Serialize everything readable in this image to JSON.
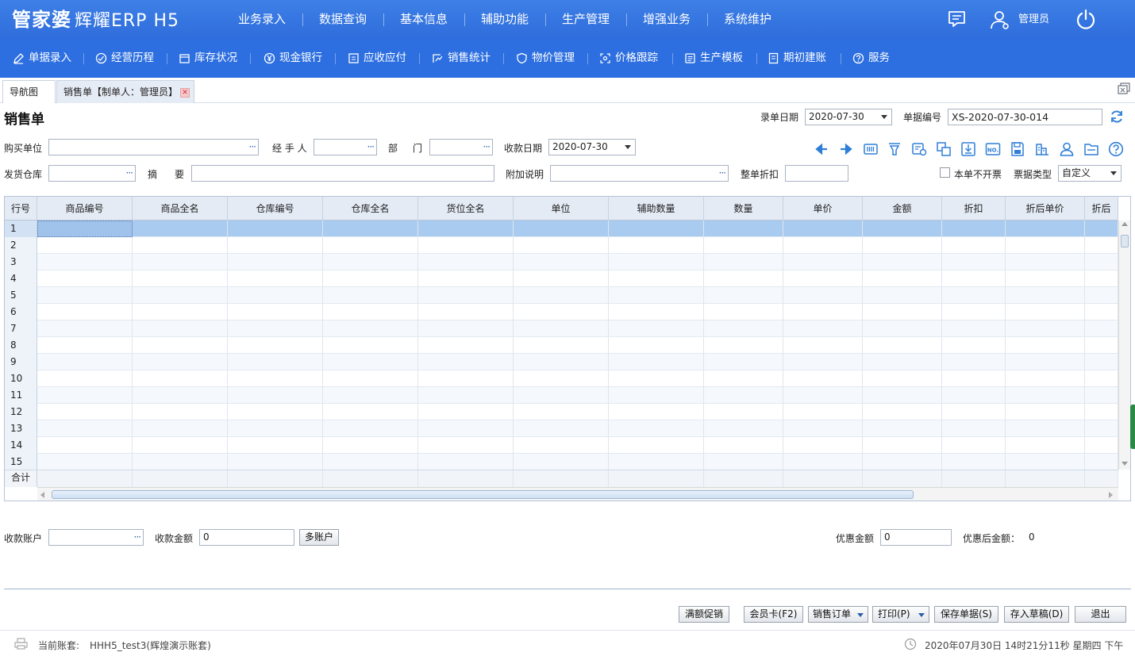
{
  "app": {
    "logo_main": "管家婆",
    "logo_sub": "辉耀ERP H5",
    "main_nav": [
      "业务录入",
      "数据查询",
      "基本信息",
      "辅助功能",
      "生产管理",
      "增强业务",
      "系统维护"
    ],
    "user_label": "管理员"
  },
  "sub_nav": [
    {
      "label": "单据录入",
      "icon": "edit-icon"
    },
    {
      "label": "经营历程",
      "icon": "history-icon"
    },
    {
      "label": "库存状况",
      "icon": "inventory-icon"
    },
    {
      "label": "现金银行",
      "icon": "yen-icon"
    },
    {
      "label": "应收应付",
      "icon": "ledger-icon"
    },
    {
      "label": "销售统计",
      "icon": "stats-icon"
    },
    {
      "label": "物价管理",
      "icon": "shield-icon"
    },
    {
      "label": "价格跟踪",
      "icon": "price-track-icon"
    },
    {
      "label": "生产模板",
      "icon": "template-icon"
    },
    {
      "label": "期初建账",
      "icon": "book-icon"
    },
    {
      "label": "服务",
      "icon": "help-icon"
    }
  ],
  "tabs": [
    {
      "label": "导航图"
    },
    {
      "label": "销售单【制单人：管理员】"
    }
  ],
  "form": {
    "title": "销售单",
    "entry_date_label": "录单日期",
    "entry_date": "2020-07-30",
    "doc_no_label": "单据编号",
    "doc_no": "XS-2020-07-30-014",
    "buyer_label": "购买单位",
    "buyer": "",
    "handler_label": "经 手 人",
    "handler": "",
    "dept_label_1": "部",
    "dept_label_2": "门",
    "dept": "",
    "receipt_date_label": "收款日期",
    "receipt_date": "2020-07-30",
    "warehouse_label": "发货仓库",
    "warehouse": "",
    "summary_label_1": "摘",
    "summary_label_2": "要",
    "summary": "",
    "extra_label": "附加说明",
    "extra": "",
    "discount_label": "整单折扣",
    "discount": "",
    "no_invoice_label": "本单不开票",
    "invoice_type_label": "票据类型",
    "invoice_type": "自定义"
  },
  "toolbar_icons": [
    "arrow-left-icon",
    "arrow-right-icon",
    "barcode-icon",
    "filter-icon",
    "scan-icon",
    "copy-icon",
    "import-icon",
    "number-icon",
    "save-icon",
    "chart-icon",
    "user-icon",
    "folder-icon",
    "help-icon"
  ],
  "grid": {
    "columns": [
      "行号",
      "商品编号",
      "商品全名",
      "仓库编号",
      "仓库全名",
      "货位全名",
      "单位",
      "辅助数量",
      "数量",
      "单价",
      "金额",
      "折扣",
      "折后单价",
      "折后"
    ],
    "rows": [
      "1",
      "2",
      "3",
      "4",
      "5",
      "6",
      "7",
      "8",
      "9",
      "10",
      "11",
      "12",
      "13",
      "14",
      "15"
    ],
    "total_label": "合计"
  },
  "payment": {
    "account_label": "收款账户",
    "account": "",
    "amount_label": "收款金额",
    "amount": "0",
    "multi_button": "多账户",
    "discount_amount_label": "优惠金额",
    "discount_amount": "0",
    "after_discount_label": "优惠后金额：",
    "after_discount": "0"
  },
  "actions": {
    "promo": "满额促销",
    "member": "会员卡(F2)",
    "sales_order": "销售订单",
    "print": "打印(P)",
    "save": "保存单据(S)",
    "draft": "存入草稿(D)",
    "exit": "退出"
  },
  "status": {
    "account_label": "当前账套:",
    "account": "HHH5_test3(辉煌演示账套)",
    "datetime": "2020年07月30日 14时21分11秒 星期四 下午"
  },
  "colors": {
    "top_bar": "#3a7be4",
    "sub_bar": "#2d6fe0",
    "selected_row": "#a9cbef",
    "icon_blue": "#2f7fd8"
  }
}
